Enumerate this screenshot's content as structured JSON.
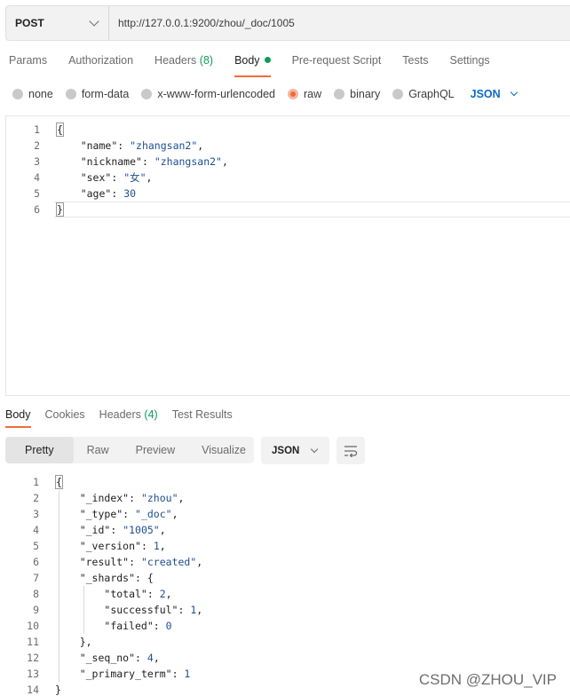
{
  "request": {
    "method": "POST",
    "url": "http://127.0.0.1:9200/zhou/_doc/1005"
  },
  "request_tabs": [
    {
      "label": "Params"
    },
    {
      "label": "Authorization"
    },
    {
      "label": "Headers",
      "count": "(8)"
    },
    {
      "label": "Body"
    },
    {
      "label": "Pre-request Script"
    },
    {
      "label": "Tests"
    },
    {
      "label": "Settings"
    }
  ],
  "body_types": [
    "none",
    "form-data",
    "x-www-form-urlencoded",
    "raw",
    "binary",
    "GraphQL"
  ],
  "body_language": "JSON",
  "request_body": {
    "line_numbers": [
      "1",
      "2",
      "3",
      "4",
      "5",
      "6"
    ],
    "open": "{",
    "close": "}",
    "fields": [
      {
        "key": "\"name\"",
        "colon": ": ",
        "value": "\"zhangsan2\"",
        "comma": ","
      },
      {
        "key": "\"nickname\"",
        "colon": ": ",
        "value": "\"zhangsan2\"",
        "comma": ","
      },
      {
        "key": "\"sex\"",
        "colon": ": ",
        "value": "\"女\"",
        "comma": ","
      },
      {
        "key": "\"age\"",
        "colon": ": ",
        "value": "30",
        "comma": ""
      }
    ]
  },
  "response_tabs": [
    {
      "label": "Body"
    },
    {
      "label": "Cookies"
    },
    {
      "label": "Headers",
      "count": "(4)"
    },
    {
      "label": "Test Results"
    }
  ],
  "response_views": [
    "Pretty",
    "Raw",
    "Preview",
    "Visualize"
  ],
  "response_format": "JSON",
  "response_body": {
    "line_numbers": [
      "1",
      "2",
      "3",
      "4",
      "5",
      "6",
      "7",
      "8",
      "9",
      "10",
      "11",
      "12",
      "13",
      "14"
    ],
    "lines": [
      {
        "indent": 0,
        "key": "",
        "colon": "",
        "value": "{",
        "comma": ""
      },
      {
        "indent": 1,
        "key": "\"_index\"",
        "colon": ": ",
        "value": "\"zhou\"",
        "comma": ","
      },
      {
        "indent": 1,
        "key": "\"_type\"",
        "colon": ": ",
        "value": "\"_doc\"",
        "comma": ","
      },
      {
        "indent": 1,
        "key": "\"_id\"",
        "colon": ": ",
        "value": "\"1005\"",
        "comma": ","
      },
      {
        "indent": 1,
        "key": "\"_version\"",
        "colon": ": ",
        "value": "1",
        "comma": ","
      },
      {
        "indent": 1,
        "key": "\"result\"",
        "colon": ": ",
        "value": "\"created\"",
        "comma": ","
      },
      {
        "indent": 1,
        "key": "\"_shards\"",
        "colon": ": ",
        "value": "{",
        "comma": ""
      },
      {
        "indent": 2,
        "key": "\"total\"",
        "colon": ": ",
        "value": "2",
        "comma": ","
      },
      {
        "indent": 2,
        "key": "\"successful\"",
        "colon": ": ",
        "value": "1",
        "comma": ","
      },
      {
        "indent": 2,
        "key": "\"failed\"",
        "colon": ": ",
        "value": "0",
        "comma": ""
      },
      {
        "indent": 1,
        "key": "",
        "colon": "",
        "value": "}",
        "comma": ","
      },
      {
        "indent": 1,
        "key": "\"_seq_no\"",
        "colon": ": ",
        "value": "4",
        "comma": ","
      },
      {
        "indent": 1,
        "key": "\"_primary_term\"",
        "colon": ": ",
        "value": "1",
        "comma": ""
      },
      {
        "indent": 0,
        "key": "",
        "colon": "",
        "value": "}",
        "comma": ""
      }
    ]
  },
  "watermark": "CSDN @ZHOU_VIP",
  "colors": {
    "accent": "#f26b3a",
    "count_green": "#0f9d58",
    "link_blue": "#0b6bcb"
  }
}
